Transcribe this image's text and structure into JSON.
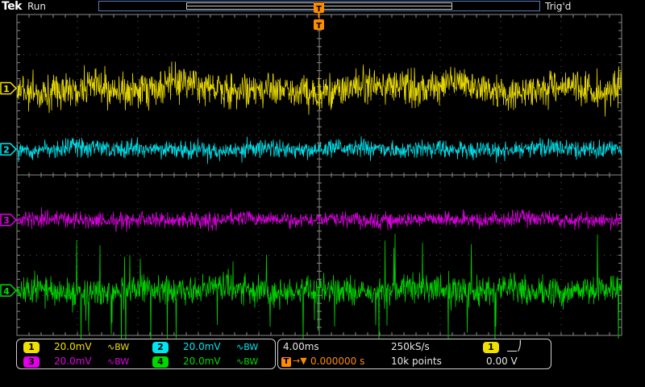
{
  "header": {
    "brand": "Tek",
    "acq_state": "Run",
    "trigger_status": "Trig'd",
    "trigger_marker": "T"
  },
  "channels": [
    {
      "num": "1",
      "scale": "20.0mV",
      "bw": "∿BW",
      "color": "#f0e000",
      "marker_level": 0.23,
      "noise": 0.62,
      "wander": 0.35,
      "spikes": 0
    },
    {
      "num": "2",
      "scale": "20.0mV",
      "bw": "∿BW",
      "color": "#00e6f0",
      "marker_level": 0.42,
      "noise": 0.33,
      "wander": 0.1,
      "spikes": 0
    },
    {
      "num": "3",
      "scale": "20.0mV",
      "bw": "∿BW",
      "color": "#e000e6",
      "marker_level": 0.64,
      "noise": 0.28,
      "wander": 0.08,
      "spikes": 0
    },
    {
      "num": "4",
      "scale": "20.0mV",
      "bw": "∿BW",
      "color": "#00d900",
      "marker_level": 0.86,
      "noise": 0.5,
      "wander": 0.2,
      "spikes": 1
    }
  ],
  "timebase": {
    "scale": "4.00ms",
    "sample_rate": "250kS/s",
    "record_length": "10k points",
    "trigger_position": "0.000000 s",
    "trigger_delay_icon": "T→▼"
  },
  "trigger": {
    "source": "1",
    "slope_icon": "rising-edge",
    "slope_glyph": "⎽⎠",
    "level": "0.00 V"
  },
  "colors": {
    "graticule": "#8a8a8a",
    "trigger": "#ff8c00",
    "record_bar": "#5b7bb5"
  }
}
